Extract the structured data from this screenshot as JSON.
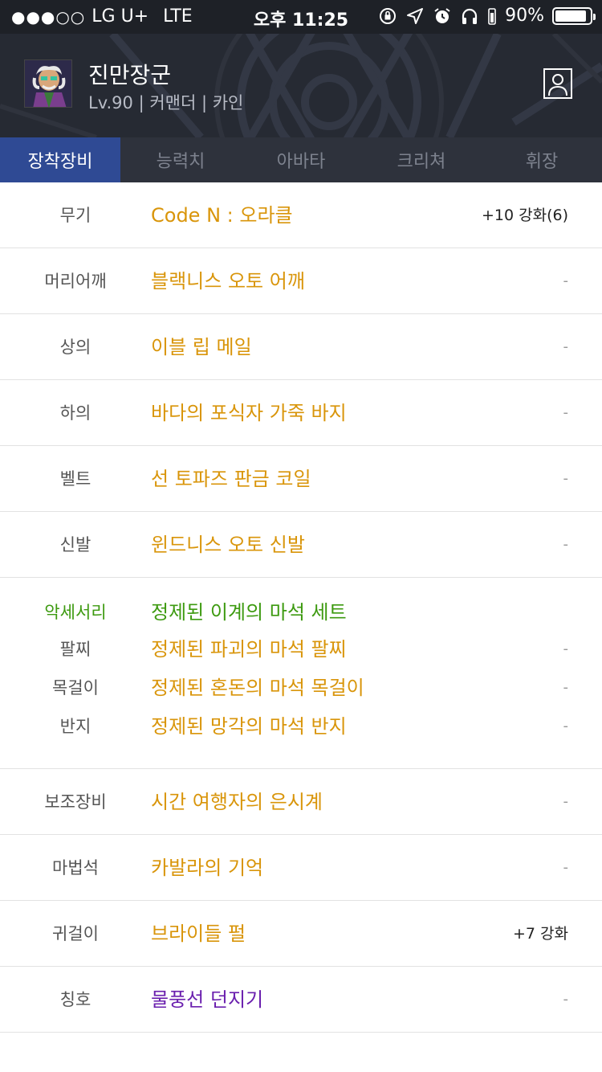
{
  "status_bar": {
    "carrier": "LG U+",
    "network": "LTE",
    "time": "오후 11:25",
    "battery_percent": "90%",
    "battery_level": 0.9
  },
  "header": {
    "character_name": "진만장군",
    "character_info": "Lv.90 | 커맨더 | 카인"
  },
  "tabs": [
    {
      "label": "장착장비",
      "active": true
    },
    {
      "label": "능력치",
      "active": false
    },
    {
      "label": "아바타",
      "active": false
    },
    {
      "label": "크리쳐",
      "active": false
    },
    {
      "label": "휘장",
      "active": false
    }
  ],
  "equipment": {
    "weapon": {
      "slot": "무기",
      "name": "Code N : 오라클",
      "extra": "+10 강화(6)"
    },
    "shoulder": {
      "slot": "머리어깨",
      "name": "블랙니스 오토 어깨",
      "extra": "-"
    },
    "top": {
      "slot": "상의",
      "name": "이블 립 메일",
      "extra": "-"
    },
    "bottom": {
      "slot": "하의",
      "name": "바다의 포식자 가죽 바지",
      "extra": "-"
    },
    "belt": {
      "slot": "벨트",
      "name": "선 토파즈 판금 코일",
      "extra": "-"
    },
    "shoes": {
      "slot": "신발",
      "name": "윈드니스 오토 신발",
      "extra": "-"
    },
    "accessory": {
      "slot": "악세서리",
      "set_name": "정제된 이계의 마석 세트",
      "items": [
        {
          "slot": "팔찌",
          "name": "정제된 파괴의 마석 팔찌",
          "extra": "-"
        },
        {
          "slot": "목걸이",
          "name": "정제된 혼돈의 마석 목걸이",
          "extra": "-"
        },
        {
          "slot": "반지",
          "name": "정제된 망각의 마석 반지",
          "extra": "-"
        }
      ]
    },
    "support": {
      "slot": "보조장비",
      "name": "시간 여행자의 은시계",
      "extra": "-"
    },
    "magic_stone": {
      "slot": "마법석",
      "name": "카발라의 기억",
      "extra": "-"
    },
    "earring": {
      "slot": "귀걸이",
      "name": "브라이들 펄",
      "extra": "+7 강화"
    },
    "title": {
      "slot": "칭호",
      "name": "물풍선 던지기",
      "extra": "-"
    }
  },
  "colors": {
    "item_unique": "#d9950a",
    "set_green": "#3d9a10",
    "title_purple": "#6a1fae",
    "tab_active_bg": "#2f4a94"
  }
}
